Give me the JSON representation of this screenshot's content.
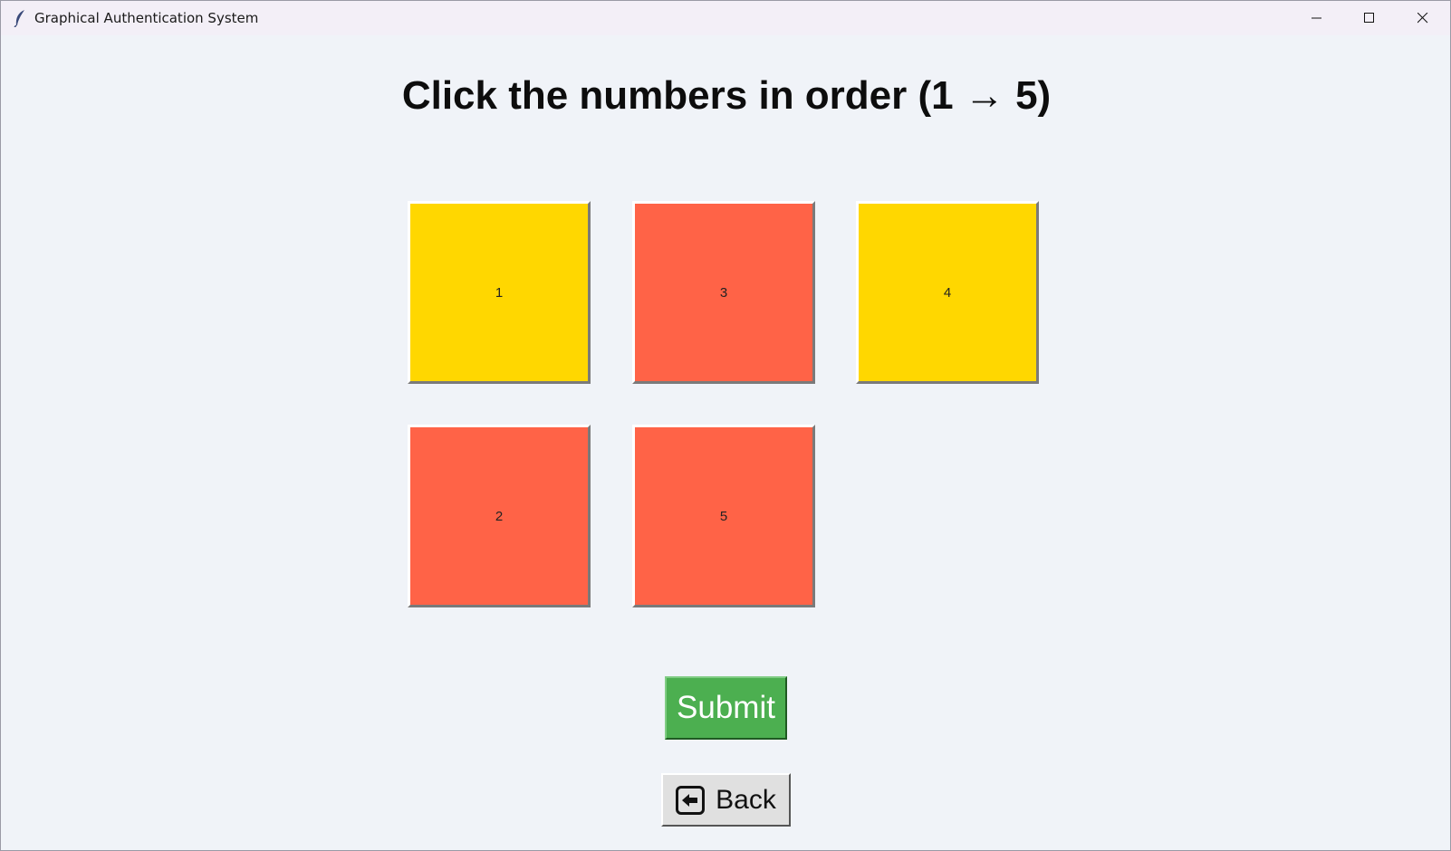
{
  "window": {
    "title": "Graphical Authentication System",
    "app_icon": "feather-icon",
    "controls": [
      "minimize-icon",
      "maximize-icon",
      "close-icon"
    ]
  },
  "heading": "Click the numbers in order (1 → 5)",
  "tiles": [
    {
      "label": "1",
      "color": "#ffd700"
    },
    {
      "label": "3",
      "color": "#ff6347"
    },
    {
      "label": "4",
      "color": "#ffd700"
    },
    {
      "label": "2",
      "color": "#ff6347"
    },
    {
      "label": "5",
      "color": "#ff6347"
    }
  ],
  "submit": {
    "label": "Submit",
    "color": "#4caf50"
  },
  "back": {
    "label": "Back",
    "icon": "left-arrow-icon"
  }
}
